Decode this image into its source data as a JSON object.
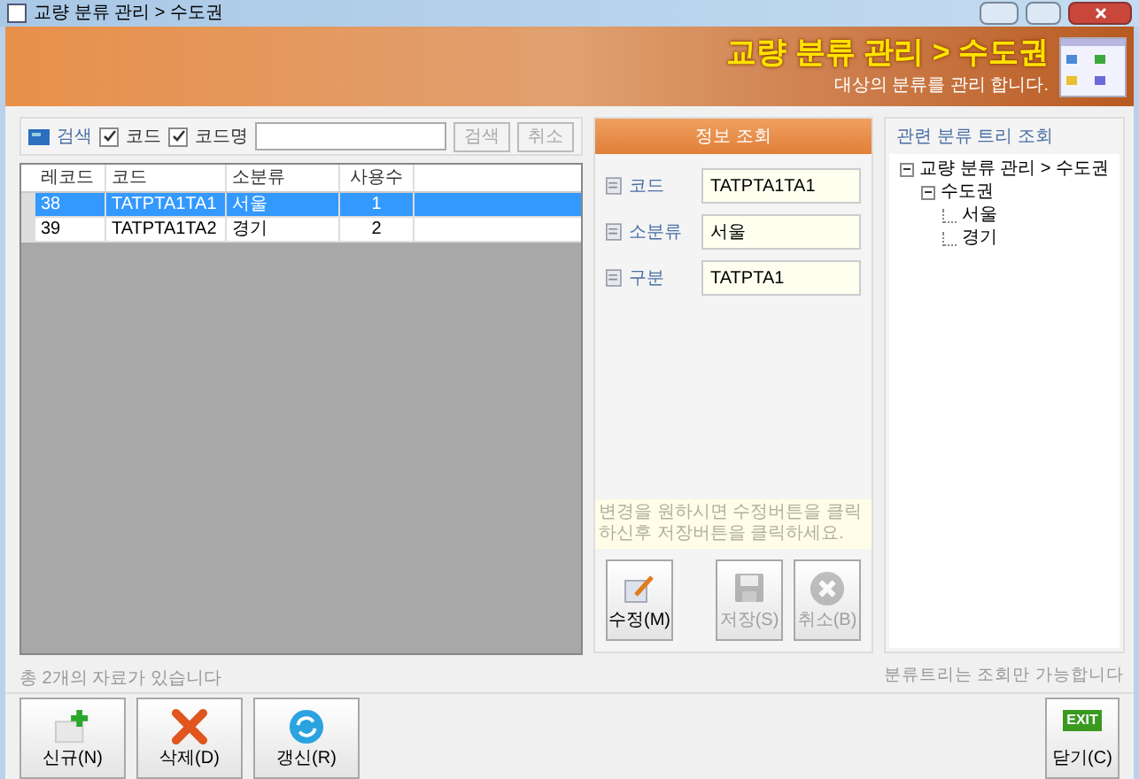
{
  "window": {
    "title": "교량 분류 관리 > 수도권"
  },
  "header": {
    "title": "교량 분류 관리 > 수도권",
    "subtitle": "대상의 분류를 관리 합니다."
  },
  "search": {
    "label": "검색",
    "filters": [
      {
        "label": "코드",
        "checked": true
      },
      {
        "label": "코드명",
        "checked": true
      }
    ],
    "buttons": [
      {
        "label": "검색",
        "disabled": true
      },
      {
        "label": "취소",
        "disabled": true
      }
    ]
  },
  "table": {
    "columns": [
      "레코드",
      "코드",
      "소분류",
      "사용수"
    ],
    "rows": [
      {
        "cells": [
          "38",
          "TATPTA1TA1",
          "서울",
          "1"
        ],
        "selected": true
      },
      {
        "cells": [
          "39",
          "TATPTA1TA2",
          "경기",
          "2"
        ],
        "selected": false
      }
    ]
  },
  "record_count": "총 2개의 자료가 있습니다",
  "info": {
    "title": "정보 조회",
    "fields": [
      {
        "label": "코드",
        "value": "TATPTA1TA1"
      },
      {
        "label": "소분류",
        "value": "서울"
      },
      {
        "label": "구분",
        "value": "TATPTA1"
      }
    ],
    "note": "변경을 원하시면 수정버튼을 클릭하신후 저장버튼을 클릭하세요.",
    "buttons": [
      {
        "kind": "edit",
        "label": "수정(M)",
        "disabled": false
      },
      {
        "kind": "save",
        "label": "저장(S)",
        "disabled": true
      },
      {
        "kind": "cancel",
        "label": "취소(B)",
        "disabled": true
      }
    ]
  },
  "tree": {
    "title": "관련 분류 트리 조회",
    "items": [
      {
        "label": "교량 분류 관리 > 수도권",
        "expanded": true,
        "children": [
          {
            "label": "수도권",
            "expanded": true,
            "children": [
              {
                "label": "서울"
              },
              {
                "label": "경기"
              }
            ]
          }
        ]
      }
    ],
    "note": "분류트리는 조회만 가능합니다"
  },
  "toolbar": [
    {
      "kind": "new",
      "label": "신규(N)"
    },
    {
      "kind": "delete",
      "label": "삭제(D)"
    },
    {
      "kind": "refresh",
      "label": "갱신(R)"
    }
  ],
  "close_button": {
    "label": "닫기(C)",
    "icon_text": "EXIT"
  }
}
